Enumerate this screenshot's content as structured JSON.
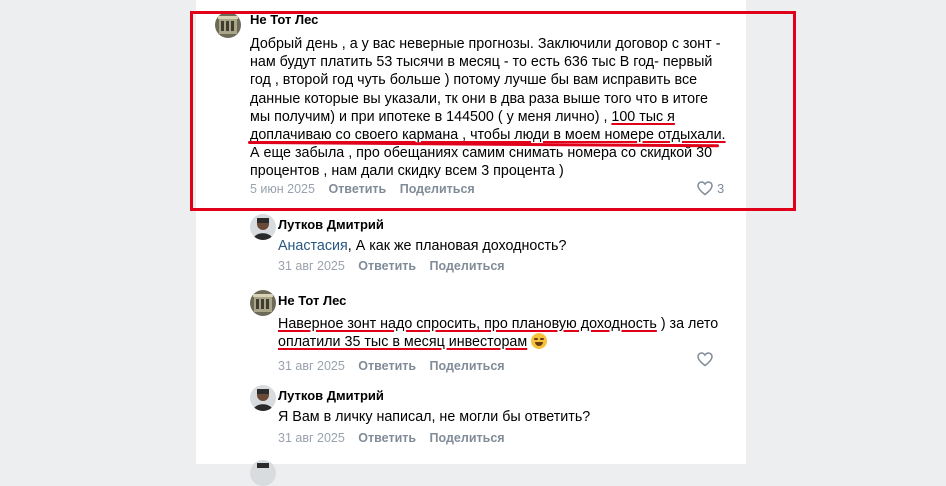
{
  "comments": [
    {
      "author": "Не Тот Лес",
      "lines": [
        "Добрый день , а у вас неверные прогнозы. Заключили договор с зонт -",
        "нам будут платить 53 тысячи в месяц - то есть 636 тыс В год- первый",
        "год , второй год чуть больше ) потому лучше бы вам исправить все",
        "данные которые вы указали, тк они в два раза выше того что в итоге",
        "мы получим) и при ипотеке в 144500 ( у меня лично) , ",
        "доплачиваю со своего кармана , чтобы люди в моем номере отдыхали.",
        "А еще забыла , про обещаниях самим снимать номера со скидкой 30",
        "процентов , нам дали скидку всем 3 процента )"
      ],
      "line5_highlight": "100 тыс я",
      "date": "5 июн 2025",
      "reply": "Ответить",
      "share": "Поделиться",
      "likes": "3"
    },
    {
      "author": "Лутков Дмитрий",
      "mention": "Анастасия",
      "text": ", А как же плановая доходность?",
      "date": "31 авг 2025",
      "reply": "Ответить",
      "share": "Поделиться"
    },
    {
      "author": "Не Тот Лес",
      "line1_highlight": "Наверное зонт надо спросить, про плановую доходность",
      "line1_rest": " ) за лето",
      "line2_highlight": "оплатили 35 тыс в месяц инвесторам",
      "line2_emoji": "laughing-emoji",
      "date": "31 авг 2025",
      "reply": "Ответить",
      "share": "Поделиться"
    },
    {
      "author": "Лутков Дмитрий",
      "text": "Я Вам в личку написал, не могли бы ответить?",
      "date": "31 авг 2025",
      "reply": "Ответить",
      "share": "Поделиться"
    }
  ],
  "colors": {
    "highlight": "#e0001a",
    "link": "#2a5885",
    "meta": "#818c99"
  }
}
